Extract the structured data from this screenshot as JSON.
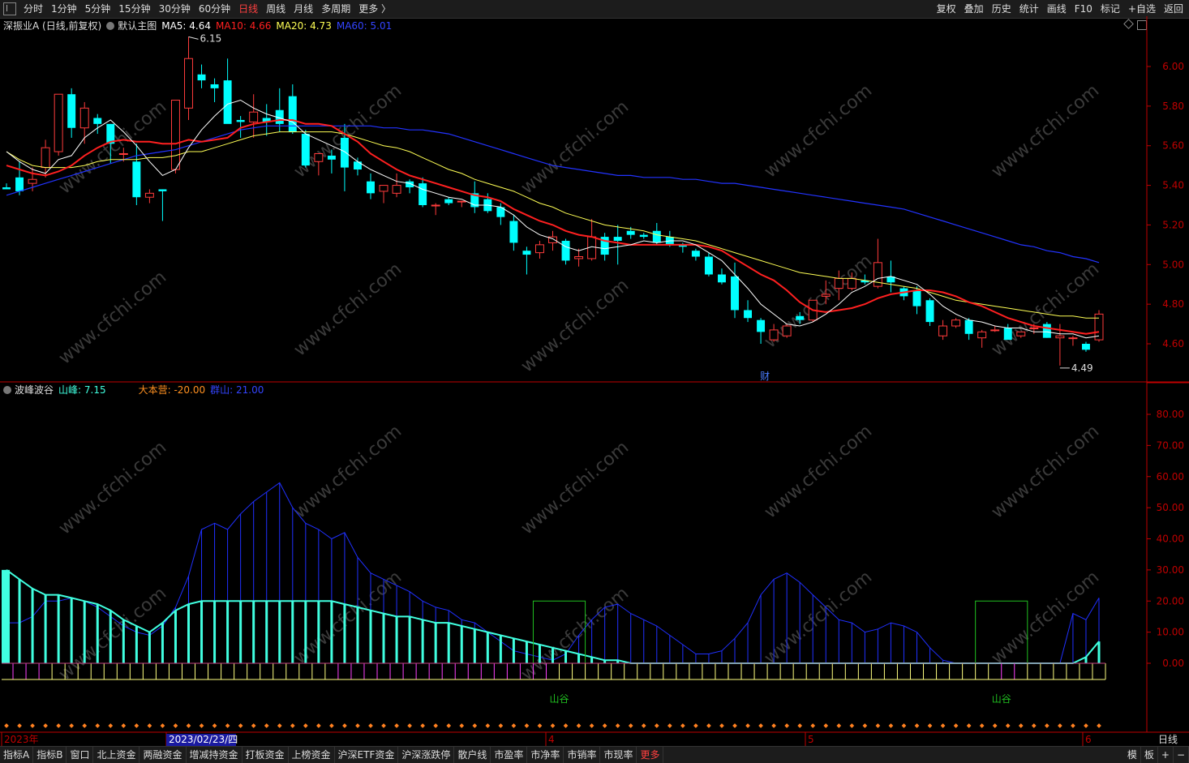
{
  "toolbar": {
    "periods": [
      "分时",
      "1分钟",
      "5分钟",
      "15分钟",
      "30分钟",
      "60分钟",
      "日线",
      "周线",
      "月线",
      "多周期",
      "更多 〉"
    ],
    "active_period": "日线",
    "tools": [
      "复权",
      "叠加",
      "历史",
      "统计",
      "画线",
      "F10",
      "标记",
      "+自选",
      "返回"
    ]
  },
  "main_info": {
    "stock": "深振业A (日线,前复权)",
    "template": "默认主图",
    "ma5": "MA5: 4.64",
    "ma10": "MA10: 4.66",
    "ma20": "MA20: 4.73",
    "ma60": "MA60: 5.01"
  },
  "sub_info": {
    "name": "波峰波谷",
    "shanfeng": "山峰: 7.15",
    "dabenying": "大本营: -20.00",
    "qunshan": "群山: 21.00"
  },
  "colors": {
    "up": "#ff3b3b",
    "down": "#00ffff",
    "ma5": "#ffffff",
    "ma10": "#ff2020",
    "ma20": "#ffff55",
    "ma60": "#2233ff",
    "axis": "#c00000",
    "shanfeng": "#40ffe0",
    "qunshan": "#2030ff",
    "valley": "#20c020",
    "dabenying_up": "#ffff80",
    "dabenying_down": "#ff40ff"
  },
  "price_axis": {
    "ticks": [
      "6.00",
      "5.80",
      "5.60",
      "5.40",
      "5.20",
      "5.00",
      "4.80",
      "4.60"
    ]
  },
  "sub_axis": {
    "ticks": [
      "80.00",
      "70.00",
      "60.00",
      "50.00",
      "40.00",
      "30.00",
      "20.00",
      "10.00",
      "0.00"
    ]
  },
  "annotations": {
    "high_label": "6.15",
    "low_label": "4.49",
    "cai_label": "财",
    "valley_label": "山谷",
    "watermark": "www.cfchi.com"
  },
  "date_axis": {
    "labels": [
      "2023年",
      "2023/02/23/四",
      "4",
      "5",
      "6"
    ],
    "right_label": "日线"
  },
  "bottom_tabs": [
    "指标A",
    "指标B",
    "窗口",
    "北上资金",
    "两融资金",
    "增减持资金",
    "打板资金",
    "上榜资金",
    "沪深ETF资金",
    "沪深涨跌停",
    "散户线",
    "市盈率",
    "市净率",
    "市销率",
    "市现率",
    "更多"
  ],
  "bottom_right": [
    "模",
    "板",
    "+",
    "−"
  ],
  "chart_data": [
    {
      "type": "candlestick",
      "title": "深振业A (日线,前复权)",
      "ylim": [
        4.47,
        6.15
      ],
      "ohlc": [
        [
          5.39,
          5.41,
          5.38,
          5.38
        ],
        [
          5.44,
          5.52,
          5.35,
          5.37
        ],
        [
          5.41,
          5.49,
          5.37,
          5.43
        ],
        [
          5.49,
          5.63,
          5.44,
          5.59
        ],
        [
          5.57,
          5.86,
          5.55,
          5.86
        ],
        [
          5.86,
          5.89,
          5.64,
          5.69
        ],
        [
          5.69,
          5.82,
          5.61,
          5.79
        ],
        [
          5.74,
          5.76,
          5.66,
          5.71
        ],
        [
          5.71,
          5.71,
          5.51,
          5.61
        ],
        [
          5.56,
          5.59,
          5.52,
          5.56
        ],
        [
          5.52,
          5.61,
          5.3,
          5.34
        ],
        [
          5.34,
          5.38,
          5.31,
          5.36
        ],
        [
          5.38,
          5.38,
          5.22,
          5.37
        ],
        [
          5.48,
          5.83,
          5.46,
          5.83
        ],
        [
          5.79,
          6.15,
          5.73,
          6.04
        ],
        [
          5.96,
          6.01,
          5.89,
          5.93
        ],
        [
          5.91,
          5.94,
          5.82,
          5.89
        ],
        [
          5.93,
          6.04,
          5.72,
          5.71
        ],
        [
          5.73,
          5.75,
          5.64,
          5.72
        ],
        [
          5.72,
          5.86,
          5.64,
          5.77
        ],
        [
          5.74,
          5.81,
          5.65,
          5.72
        ],
        [
          5.78,
          5.89,
          5.67,
          5.71
        ],
        [
          5.85,
          5.91,
          5.66,
          5.67
        ],
        [
          5.66,
          5.68,
          5.49,
          5.5
        ],
        [
          5.52,
          5.56,
          5.45,
          5.56
        ],
        [
          5.55,
          5.58,
          5.46,
          5.53
        ],
        [
          5.64,
          5.71,
          5.37,
          5.49
        ],
        [
          5.52,
          5.54,
          5.45,
          5.48
        ],
        [
          5.42,
          5.46,
          5.33,
          5.36
        ],
        [
          5.37,
          5.4,
          5.31,
          5.4
        ],
        [
          5.36,
          5.46,
          5.34,
          5.4
        ],
        [
          5.42,
          5.43,
          5.36,
          5.39
        ],
        [
          5.41,
          5.44,
          5.29,
          5.3
        ],
        [
          5.3,
          5.31,
          5.25,
          5.3
        ],
        [
          5.33,
          5.34,
          5.3,
          5.31
        ],
        [
          5.32,
          5.32,
          5.29,
          5.32
        ],
        [
          5.36,
          5.42,
          5.26,
          5.29
        ],
        [
          5.33,
          5.36,
          5.26,
          5.27
        ],
        [
          5.29,
          5.31,
          5.2,
          5.24
        ],
        [
          5.22,
          5.25,
          5.07,
          5.11
        ],
        [
          5.07,
          5.09,
          4.95,
          5.05
        ],
        [
          5.06,
          5.12,
          5.03,
          5.1
        ],
        [
          5.11,
          5.17,
          5.07,
          5.14
        ],
        [
          5.12,
          5.13,
          5.0,
          5.02
        ],
        [
          5.03,
          5.08,
          4.99,
          5.04
        ],
        [
          5.03,
          5.23,
          5.02,
          5.14
        ],
        [
          5.14,
          5.16,
          5.02,
          5.05
        ],
        [
          5.14,
          5.2,
          5.0,
          5.12
        ],
        [
          5.17,
          5.19,
          5.13,
          5.15
        ],
        [
          5.15,
          5.16,
          5.13,
          5.14
        ],
        [
          5.17,
          5.21,
          5.1,
          5.11
        ],
        [
          5.14,
          5.17,
          5.09,
          5.1
        ],
        [
          5.1,
          5.11,
          5.06,
          5.09
        ],
        [
          5.07,
          5.08,
          5.02,
          5.04
        ],
        [
          5.04,
          5.06,
          4.94,
          4.95
        ],
        [
          4.95,
          4.98,
          4.9,
          4.91
        ],
        [
          4.94,
          5.01,
          4.73,
          4.77
        ],
        [
          4.77,
          4.82,
          4.71,
          4.73
        ],
        [
          4.72,
          4.73,
          4.6,
          4.66
        ],
        [
          4.62,
          4.7,
          4.61,
          4.67
        ],
        [
          4.64,
          4.7,
          4.63,
          4.69
        ],
        [
          4.74,
          4.76,
          4.7,
          4.72
        ],
        [
          4.72,
          4.82,
          4.71,
          4.82
        ],
        [
          4.84,
          4.92,
          4.8,
          4.85
        ],
        [
          4.88,
          4.97,
          4.82,
          4.93
        ],
        [
          4.88,
          4.96,
          4.87,
          4.93
        ],
        [
          4.92,
          4.95,
          4.9,
          4.91
        ],
        [
          4.89,
          5.13,
          4.88,
          5.01
        ],
        [
          4.94,
          5.02,
          4.86,
          4.91
        ],
        [
          4.88,
          4.89,
          4.82,
          4.84
        ],
        [
          4.87,
          4.89,
          4.75,
          4.79
        ],
        [
          4.82,
          4.83,
          4.69,
          4.71
        ],
        [
          4.64,
          4.72,
          4.62,
          4.69
        ],
        [
          4.69,
          4.73,
          4.68,
          4.72
        ],
        [
          4.72,
          4.73,
          4.62,
          4.65
        ],
        [
          4.63,
          4.67,
          4.58,
          4.66
        ],
        [
          4.67,
          4.69,
          4.66,
          4.67
        ],
        [
          4.68,
          4.7,
          4.62,
          4.62
        ],
        [
          4.64,
          4.66,
          4.63,
          4.66
        ],
        [
          4.68,
          4.7,
          4.65,
          4.68
        ],
        [
          4.7,
          4.71,
          4.63,
          4.63
        ],
        [
          4.63,
          4.7,
          4.49,
          4.64
        ],
        [
          4.63,
          4.64,
          4.59,
          4.63
        ],
        [
          4.6,
          4.61,
          4.56,
          4.57
        ],
        [
          4.62,
          4.77,
          4.61,
          4.75
        ]
      ],
      "ma5": [
        5.57,
        5.52,
        5.48,
        5.46,
        5.53,
        5.55,
        5.64,
        5.69,
        5.73,
        5.67,
        5.6,
        5.52,
        5.45,
        5.48,
        5.59,
        5.68,
        5.75,
        5.81,
        5.83,
        5.79,
        5.76,
        5.74,
        5.72,
        5.66,
        5.63,
        5.6,
        5.57,
        5.52,
        5.48,
        5.45,
        5.42,
        5.41,
        5.38,
        5.36,
        5.34,
        5.33,
        5.3,
        5.3,
        5.29,
        5.25,
        5.19,
        5.15,
        5.13,
        5.09,
        5.07,
        5.09,
        5.08,
        5.09,
        5.1,
        5.12,
        5.11,
        5.12,
        5.12,
        5.1,
        5.06,
        5.02,
        4.95,
        4.88,
        4.8,
        4.75,
        4.7,
        4.69,
        4.71,
        4.75,
        4.8,
        4.86,
        4.89,
        4.93,
        4.94,
        4.92,
        4.9,
        4.85,
        4.79,
        4.75,
        4.72,
        4.71,
        4.69,
        4.68,
        4.68,
        4.66,
        4.66,
        4.65,
        4.65,
        4.63,
        4.64
      ],
      "ma10": [
        5.5,
        5.48,
        5.46,
        5.45,
        5.47,
        5.5,
        5.55,
        5.59,
        5.62,
        5.63,
        5.62,
        5.62,
        5.61,
        5.61,
        5.63,
        5.62,
        5.63,
        5.64,
        5.69,
        5.71,
        5.72,
        5.73,
        5.73,
        5.71,
        5.71,
        5.7,
        5.66,
        5.62,
        5.56,
        5.52,
        5.48,
        5.45,
        5.43,
        5.41,
        5.39,
        5.37,
        5.35,
        5.34,
        5.32,
        5.28,
        5.25,
        5.22,
        5.2,
        5.17,
        5.15,
        5.14,
        5.12,
        5.11,
        5.1,
        5.1,
        5.1,
        5.1,
        5.1,
        5.1,
        5.09,
        5.07,
        5.03,
        4.99,
        4.95,
        4.92,
        4.87,
        4.81,
        4.77,
        4.76,
        4.77,
        4.78,
        4.8,
        4.83,
        4.85,
        4.86,
        4.87,
        4.87,
        4.86,
        4.84,
        4.81,
        4.79,
        4.76,
        4.73,
        4.71,
        4.69,
        4.68,
        4.67,
        4.66,
        4.65,
        4.66
      ],
      "ma20": [
        5.57,
        5.53,
        5.5,
        5.49,
        5.49,
        5.49,
        5.5,
        5.52,
        5.53,
        5.53,
        5.53,
        5.54,
        5.54,
        5.55,
        5.57,
        5.57,
        5.59,
        5.61,
        5.63,
        5.65,
        5.66,
        5.67,
        5.67,
        5.67,
        5.67,
        5.67,
        5.66,
        5.64,
        5.62,
        5.6,
        5.59,
        5.57,
        5.54,
        5.51,
        5.48,
        5.46,
        5.43,
        5.41,
        5.39,
        5.37,
        5.34,
        5.31,
        5.29,
        5.26,
        5.24,
        5.22,
        5.2,
        5.19,
        5.18,
        5.17,
        5.15,
        5.14,
        5.13,
        5.12,
        5.1,
        5.08,
        5.06,
        5.04,
        5.02,
        5.0,
        4.98,
        4.96,
        4.95,
        4.94,
        4.93,
        4.93,
        4.92,
        4.91,
        4.9,
        4.89,
        4.88,
        4.86,
        4.84,
        4.82,
        4.81,
        4.8,
        4.79,
        4.78,
        4.77,
        4.76,
        4.75,
        4.74,
        4.74,
        4.73,
        4.73
      ],
      "ma60": [
        5.35,
        5.37,
        5.39,
        5.41,
        5.43,
        5.45,
        5.47,
        5.49,
        5.51,
        5.53,
        5.55,
        5.56,
        5.57,
        5.58,
        5.6,
        5.62,
        5.64,
        5.66,
        5.68,
        5.69,
        5.7,
        5.7,
        5.7,
        5.7,
        5.7,
        5.7,
        5.7,
        5.7,
        5.7,
        5.69,
        5.69,
        5.68,
        5.68,
        5.67,
        5.66,
        5.64,
        5.62,
        5.6,
        5.58,
        5.56,
        5.54,
        5.52,
        5.5,
        5.49,
        5.48,
        5.47,
        5.46,
        5.45,
        5.45,
        5.44,
        5.44,
        5.44,
        5.43,
        5.43,
        5.42,
        5.41,
        5.41,
        5.4,
        5.39,
        5.38,
        5.37,
        5.36,
        5.35,
        5.34,
        5.33,
        5.32,
        5.31,
        5.3,
        5.29,
        5.28,
        5.26,
        5.24,
        5.22,
        5.2,
        5.18,
        5.16,
        5.14,
        5.12,
        5.1,
        5.09,
        5.07,
        5.06,
        5.04,
        5.03,
        5.01
      ]
    },
    {
      "type": "bar",
      "title": "波峰波谷",
      "ylim": [
        -5,
        90
      ],
      "series": [
        {
          "name": "山峰",
          "values": [
            30,
            27,
            24,
            22,
            22,
            21,
            20,
            19,
            17,
            14,
            12,
            10,
            13,
            17,
            19,
            20,
            20,
            20,
            20,
            20,
            20,
            20,
            20,
            20,
            20,
            20,
            19,
            18,
            17,
            16,
            15,
            15,
            14,
            13,
            13,
            12,
            11,
            10,
            9,
            8,
            7,
            6,
            5,
            4,
            3,
            2,
            1,
            1,
            0,
            0,
            0,
            0,
            0,
            0,
            0,
            0,
            0,
            0,
            0,
            0,
            0,
            0,
            0,
            0,
            0,
            0,
            0,
            0,
            0,
            0,
            0,
            0,
            0,
            0,
            0,
            0,
            0,
            0,
            0,
            0,
            0,
            0,
            0,
            2,
            7
          ]
        },
        {
          "name": "群山",
          "values": [
            13,
            13,
            15,
            20,
            20,
            21,
            20,
            18,
            15,
            12,
            10,
            9,
            12,
            18,
            28,
            43,
            45,
            43,
            48,
            52,
            55,
            58,
            50,
            45,
            43,
            40,
            42,
            34,
            29,
            27,
            25,
            23,
            20,
            18,
            17,
            14,
            13,
            10,
            7,
            4,
            3,
            2,
            1,
            3,
            9,
            14,
            18,
            19,
            16,
            14,
            12,
            9,
            6,
            3,
            3,
            4,
            8,
            13,
            22,
            27,
            29,
            26,
            22,
            18,
            14,
            13,
            10,
            11,
            13,
            12,
            10,
            5,
            1,
            0,
            0,
            0,
            0,
            0,
            0,
            0,
            0,
            0,
            16,
            14,
            21
          ]
        },
        {
          "name": "大本营",
          "values": [
            -20,
            -20,
            -20,
            -20,
            -20,
            -20,
            -20,
            -20,
            -20,
            -20,
            -20,
            -20,
            -20,
            -20,
            -20,
            -20,
            -20,
            -20,
            -20,
            -20,
            -20,
            -20,
            -20,
            -20,
            -20,
            -20,
            -20,
            -20,
            -20,
            -20,
            -20,
            -20,
            -20,
            -20,
            -20,
            -20,
            -20,
            -20,
            -20,
            -20,
            -20,
            -20,
            -20,
            -20,
            -20,
            -20,
            -20,
            -20,
            -20,
            -20,
            -20,
            -20,
            -20,
            -20,
            -20,
            -20,
            -20,
            -20,
            -20,
            -20,
            -20,
            -20,
            -20,
            -20,
            -20,
            -20,
            -20,
            -20,
            -20,
            -20,
            -20,
            -20,
            -20,
            -20,
            -20,
            -20,
            -20,
            -20,
            -20,
            -20,
            -20,
            -20,
            -20,
            -20,
            -20
          ]
        }
      ],
      "valley_boxes": [
        [
          41,
          44
        ],
        [
          75,
          78
        ]
      ]
    }
  ]
}
